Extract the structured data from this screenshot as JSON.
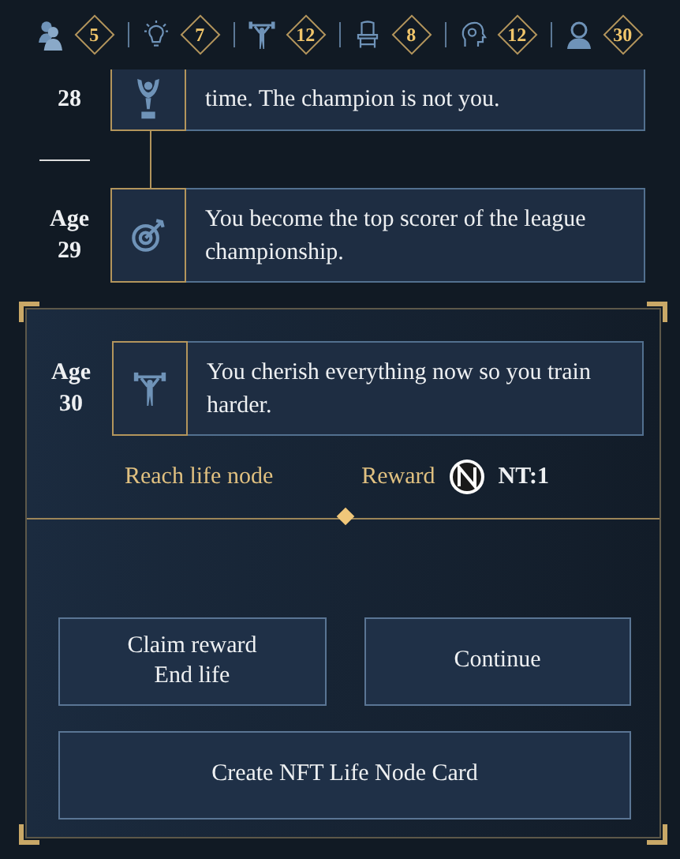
{
  "stats": [
    {
      "kind": "couple",
      "value": "5"
    },
    {
      "kind": "bulb",
      "value": "7"
    },
    {
      "kind": "lifter",
      "value": "12"
    },
    {
      "kind": "throne",
      "value": "8"
    },
    {
      "kind": "head",
      "value": "12"
    },
    {
      "kind": "person",
      "value": "30"
    }
  ],
  "events": [
    {
      "age": "28",
      "kind": "trophy",
      "text": "time. The champion is not you.",
      "partial": true
    },
    {
      "age_label": "Age",
      "age": "29",
      "kind": "target",
      "text": "You become the top scorer of the league championship.",
      "partial": false
    }
  ],
  "current": {
    "age_label": "Age",
    "age": "30",
    "kind": "lifter",
    "text": "You cherish everything now so you train harder.",
    "node_label": "Reach life node",
    "reward_label": "Reward",
    "reward_value": "NT:1"
  },
  "buttons": [
    {
      "label": "Claim reward\nEnd life",
      "kind": "half"
    },
    {
      "label": "Continue",
      "kind": "half"
    },
    {
      "label": "Create NFT Life Node Card",
      "kind": "full"
    }
  ]
}
